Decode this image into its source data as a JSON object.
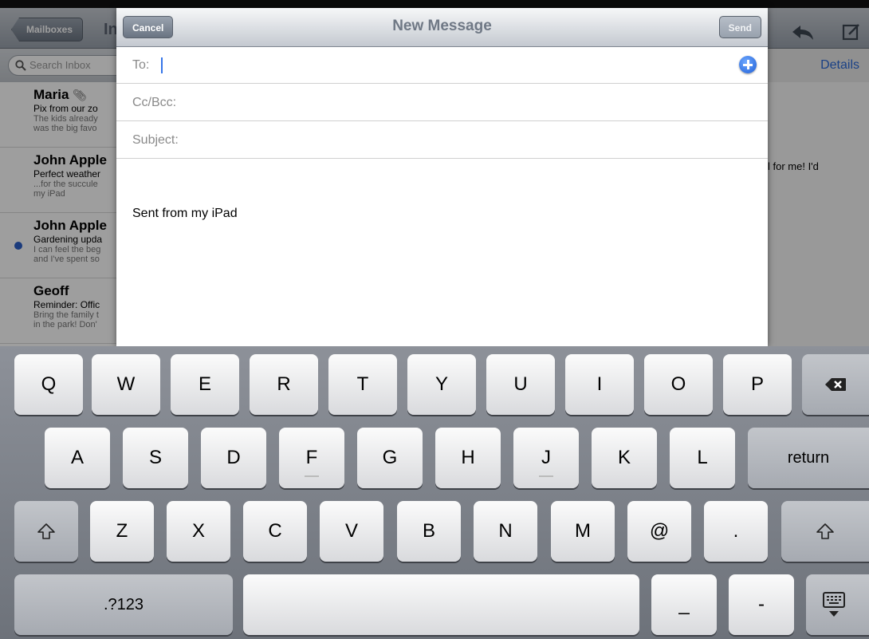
{
  "background": {
    "mailboxes_button": "Mailboxes",
    "inbox_title_fragment": "In",
    "search_placeholder": "Search Inbox",
    "details_link": "Details",
    "mail_items": [
      {
        "sender": "Maria",
        "subject": "Pix from our zo",
        "preview1": "The kids already",
        "preview2": "was the big favo",
        "attachment": true,
        "unread": false
      },
      {
        "sender": "John Apple",
        "subject": "Perfect weather",
        "preview1": "...for the succule",
        "preview2": "my iPad",
        "attachment": false,
        "unread": false
      },
      {
        "sender": "John Apple",
        "subject": "Gardening upda",
        "preview1": "I can feel the beg",
        "preview2": "and I've spent so",
        "attachment": false,
        "unread": true
      },
      {
        "sender": "Geoff",
        "subject": "Reminder: Offic",
        "preview1": "Bring the family t",
        "preview2": "in the park! Don'",
        "attachment": false,
        "unread": false
      }
    ],
    "detail_text_fragment": "l for me! I'd"
  },
  "compose": {
    "title": "New Message",
    "cancel_label": "Cancel",
    "send_label": "Send",
    "to_label": "To:",
    "ccbcc_label": "Cc/Bcc:",
    "subject_label": "Subject:",
    "body_signature": "Sent from my iPad"
  },
  "keyboard": {
    "row1": [
      "Q",
      "W",
      "E",
      "R",
      "T",
      "Y",
      "U",
      "I",
      "O",
      "P"
    ],
    "row2": [
      "A",
      "S",
      "D",
      "F",
      "G",
      "H",
      "J",
      "K",
      "L"
    ],
    "row3": [
      "Z",
      "X",
      "C",
      "V",
      "B",
      "N",
      "M",
      "@",
      "."
    ],
    "return_label": "return",
    "numbers_label": ".?123",
    "underscore_label": "_",
    "dash_label": "-",
    "icons": {
      "delete": "backspace-icon",
      "shift": "shift-icon",
      "hide": "keyboard-hide-icon"
    }
  }
}
